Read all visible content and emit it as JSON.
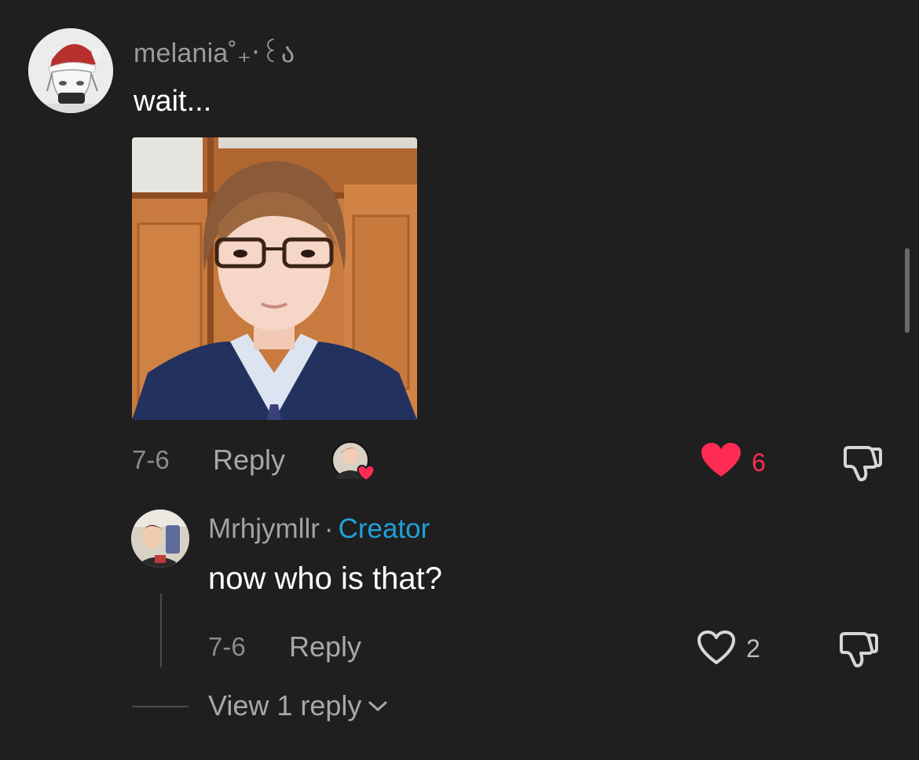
{
  "comment": {
    "username": "melania˚₊‧꒰ა",
    "text": "wait...",
    "date": "7-6",
    "reply_label": "Reply",
    "like_count": "6",
    "liked": true
  },
  "reply": {
    "username": "Mrhjymllr",
    "separator": "·",
    "badge": "Creator",
    "text": "now who is that?",
    "date": "7-6",
    "reply_label": "Reply",
    "like_count": "2",
    "liked": false
  },
  "view_replies": {
    "label": "View 1 reply"
  },
  "colors": {
    "background": "#1f1f1f",
    "like_red": "#fe2c55",
    "creator_blue": "#1fa1d8",
    "muted_text": "#a8a8a8"
  },
  "icons": {
    "like_filled": "heart-filled-icon",
    "like_outline": "heart-outline-icon",
    "dislike": "thumbs-down-icon",
    "expand": "chevron-down-icon"
  }
}
